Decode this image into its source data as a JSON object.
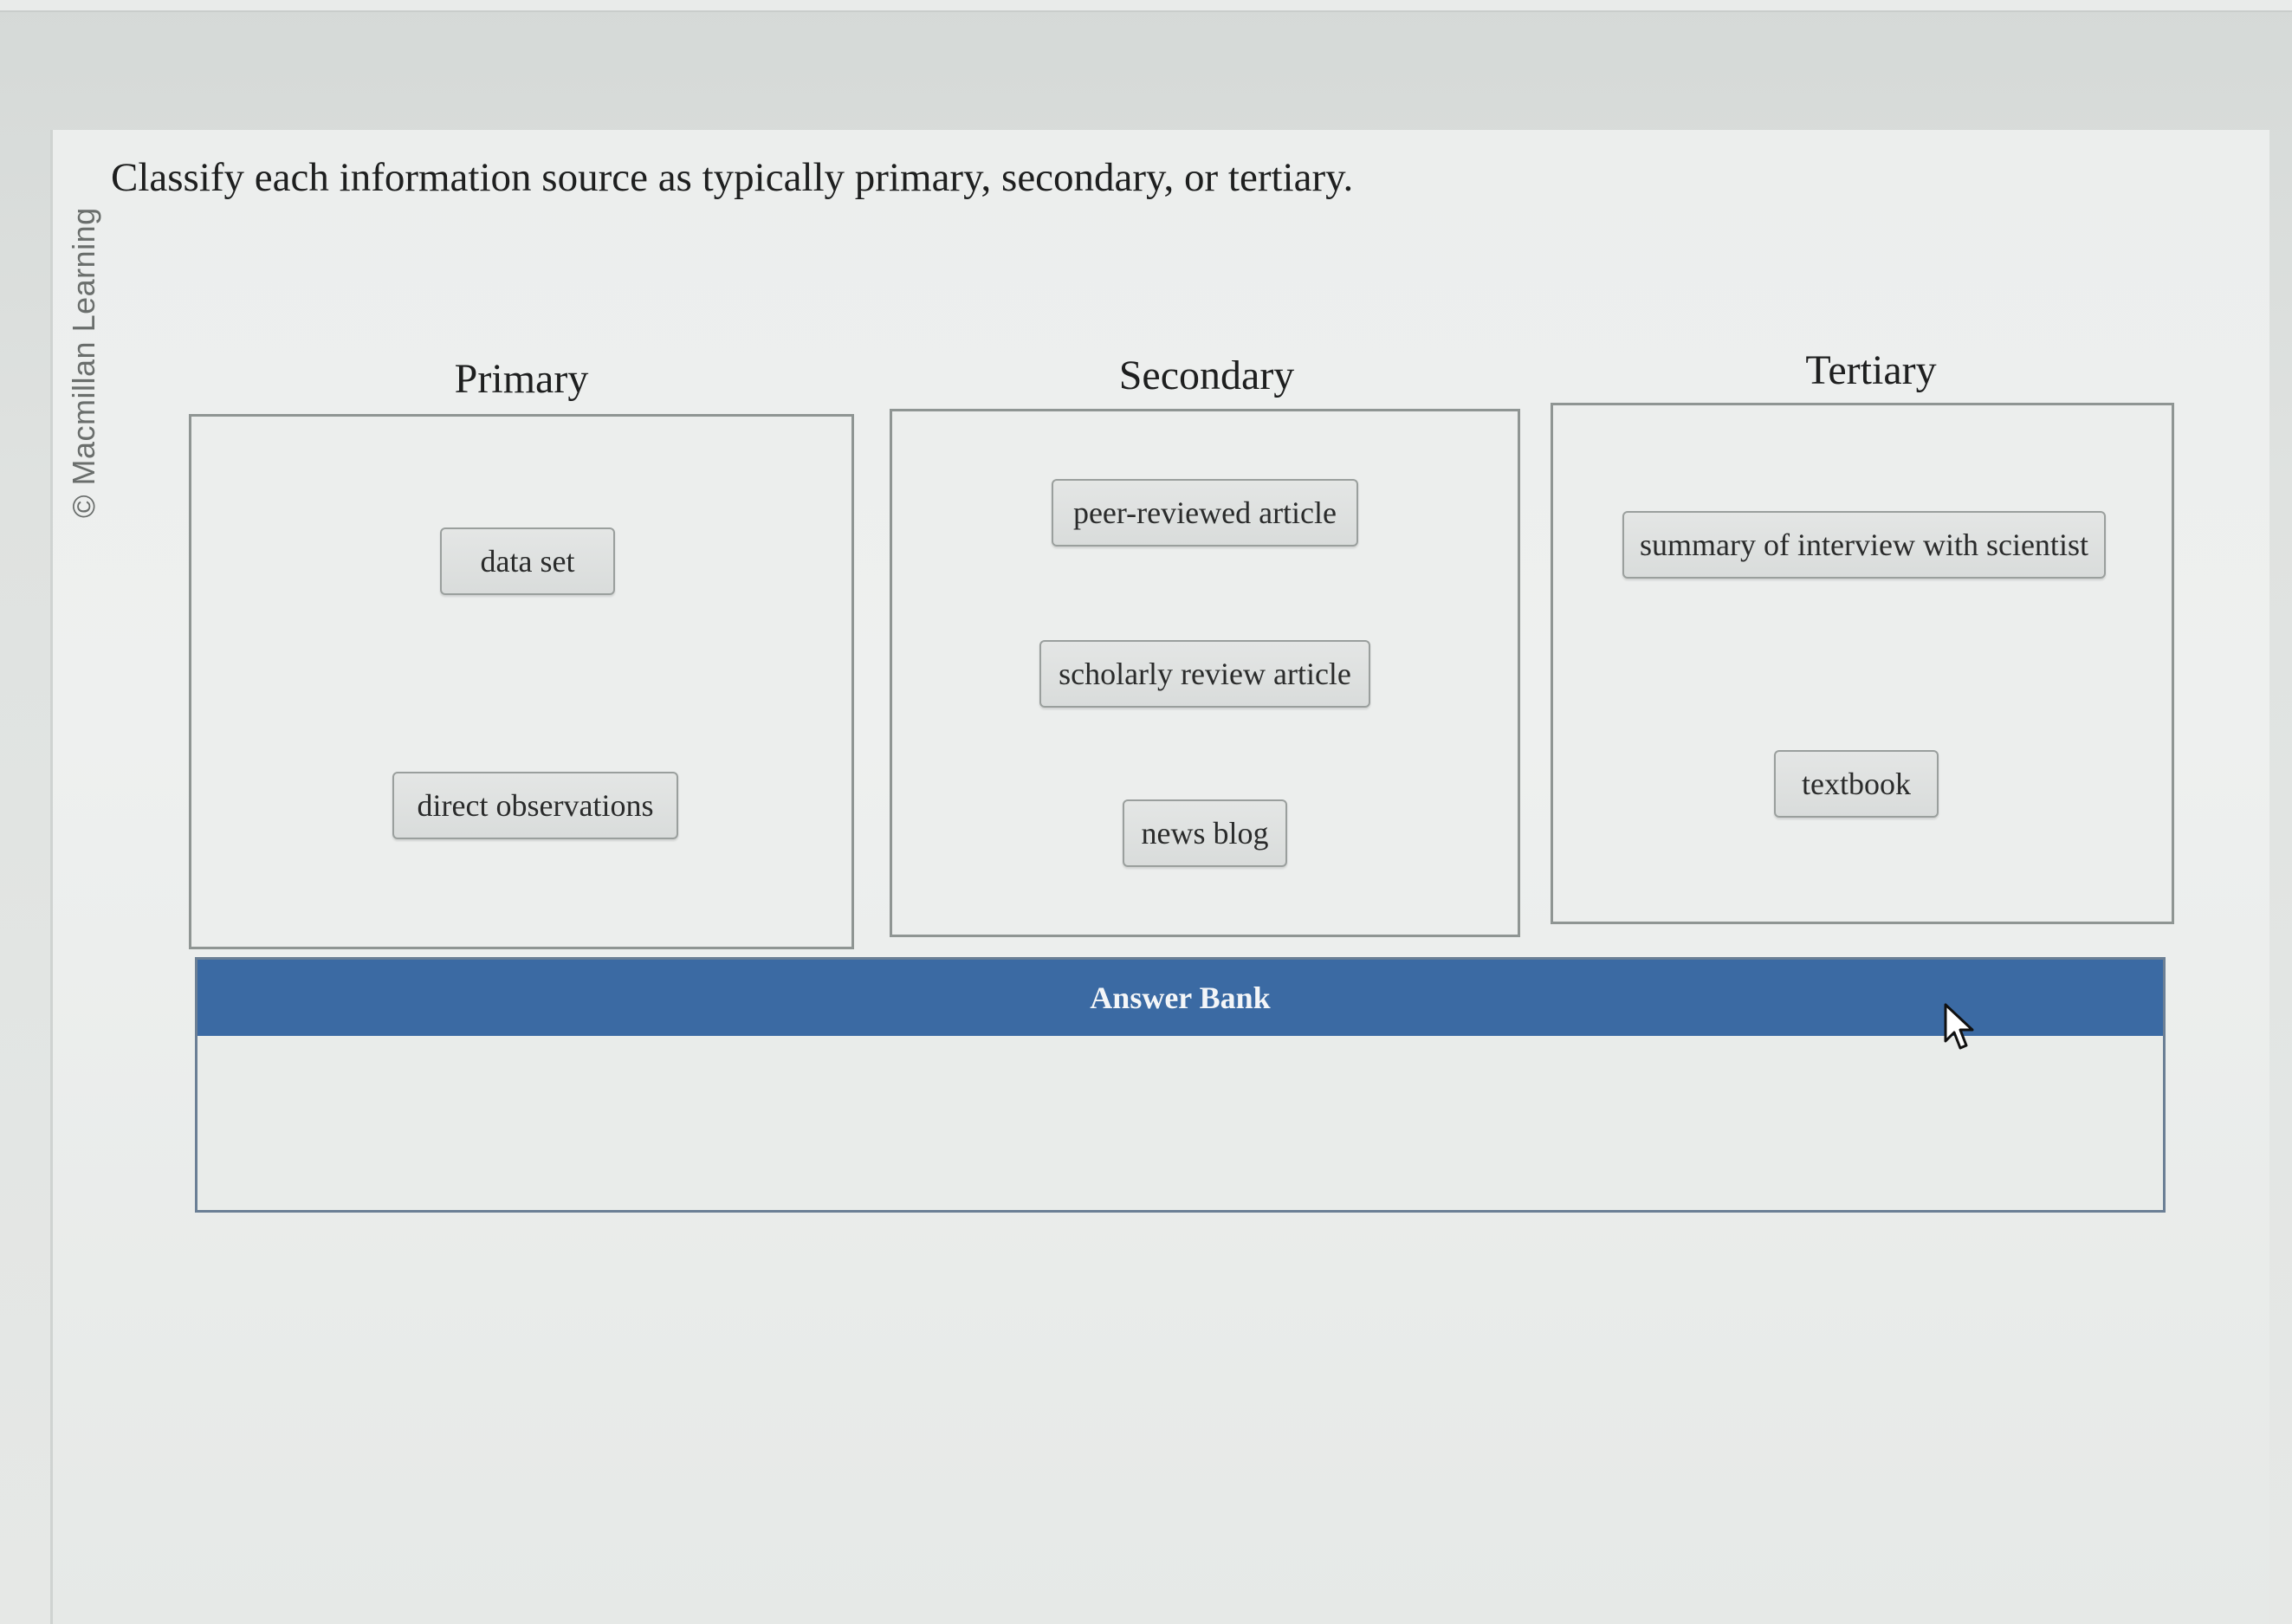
{
  "watermark": "© Macmillan Learning",
  "question": "Classify each information source as typically primary, secondary, or tertiary.",
  "categories": [
    {
      "title": "Primary",
      "items": [
        "data set",
        "direct observations"
      ]
    },
    {
      "title": "Secondary",
      "items": [
        "peer-reviewed article",
        "scholarly review article",
        "news blog"
      ]
    },
    {
      "title": "Tertiary",
      "items": [
        "summary of interview with scientist",
        "textbook"
      ]
    }
  ],
  "answer_bank": {
    "title": "Answer Bank",
    "items": []
  },
  "colors": {
    "answer_bank_header": "#3b6aa3",
    "chip_border": "#9a9f9d",
    "box_border": "#8f9593"
  },
  "icons": {
    "cursor": "mouse-pointer-icon"
  }
}
